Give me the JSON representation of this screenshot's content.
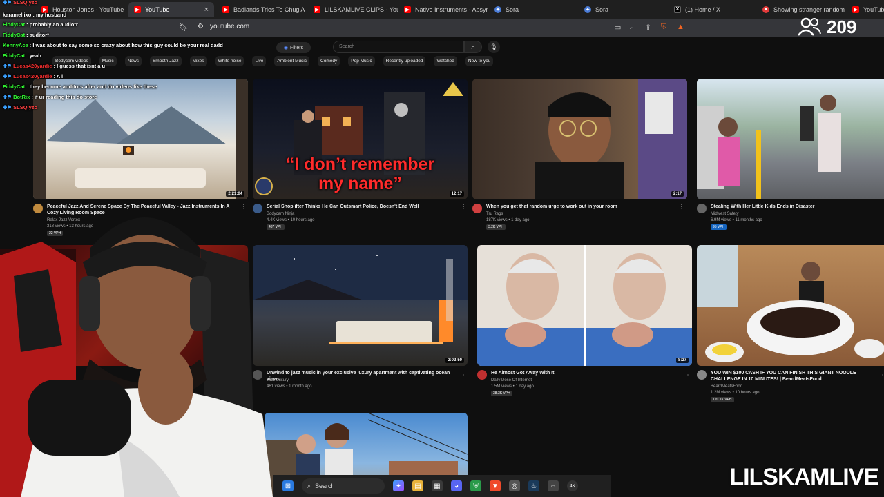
{
  "browser": {
    "tabs": [
      {
        "label": "Houston Jones - YouTube",
        "color": "#ff0000"
      },
      {
        "label": "YouTube",
        "color": "#ff0000",
        "active": true
      },
      {
        "label": "Badlands Tries To Chug A P",
        "color": "#ff0000"
      },
      {
        "label": "LILSKAMLIVE CLIPS - YouTu",
        "color": "#ff0000"
      },
      {
        "label": "Native Instruments - Absym",
        "color": "#ff0000"
      },
      {
        "label": "Sora",
        "color": "#4a7bd6"
      },
      {
        "label": "Sora",
        "color": "#4a7bd6"
      },
      {
        "label": "(1) Home / X",
        "color": "#000000"
      },
      {
        "label": "Showing stranger random",
        "color": "#e23b3b"
      },
      {
        "label": "YouTube",
        "color": "#ff0000"
      }
    ],
    "url": "youtube.com"
  },
  "youtube": {
    "filters_label": "Filters",
    "search_placeholder": "Search",
    "chips": [
      "Bodycam videos",
      "Music",
      "News",
      "Smooth Jazz",
      "Mixes",
      "White noise",
      "Live",
      "Ambient Music",
      "Comedy",
      "Pop Music",
      "Recently uploaded",
      "Watched",
      "New to you"
    ],
    "videos": [
      {
        "title": "Peaceful Jazz And Serene Space By The Peaceful Valley - Jazz Instruments In A Cozy Living Room Space",
        "channel": "Relax Jazz Vortex",
        "stats": "318 views • 13 hours ago",
        "vph": "22 VPH",
        "duration": "2:21:04",
        "avatar": "#c08a3e"
      },
      {
        "title": "Serial Shoplifter Thinks He Can Outsmart Police, Doesn't End Well",
        "channel": "Bodycam Ninja",
        "stats": "4.4K views • 10 hours ago",
        "vph": "437 VPH",
        "duration": "12:17",
        "avatar": "#3a5b8a"
      },
      {
        "title": "When you get that random urge to work out in your room",
        "channel": "Tru Rags",
        "stats": "187K views • 1 day ago",
        "vph": "3.2K VPH",
        "duration": "2:17",
        "avatar": "#d04040"
      },
      {
        "title": "Stealing With Her Little Kids Ends in Disaster",
        "channel": "Midwest Safety",
        "stats": "6.9M views • 11 months ago",
        "vph": "95 VPH",
        "duration": "",
        "avatar": "#666666"
      },
      {
        "title": "",
        "channel": "",
        "stats": "",
        "vph": "",
        "duration": "",
        "avatar": "#444444"
      },
      {
        "title": "Unwind to jazz music in your exclusive luxury apartment with captivating ocean views",
        "channel": "Jazz Luxury",
        "stats": "461 views • 1 month ago",
        "vph": "",
        "duration": "2:02:50",
        "avatar": "#555555"
      },
      {
        "title": "He Almost Got Away With It",
        "channel": "Daily Dose Of Internet",
        "stats": "1.5M views • 1 day ago",
        "vph": "38.3K VPH",
        "duration": "8:27",
        "avatar": "#c03030"
      },
      {
        "title": "YOU WIN $100 CASH IF YOU CAN FINISH THIS GIANT NOODLE CHALLENGE IN 10 MINUTES! | BeardMeatsFood",
        "channel": "BeardMeatsFood",
        "stats": "1.2M views • 10 hours ago",
        "vph": "120.1K VPH",
        "duration": "",
        "avatar": "#888888"
      },
      {
        "title": "",
        "channel": "",
        "stats": "",
        "vph": "",
        "duration": "",
        "avatar": "#444444"
      }
    ],
    "thumb_text": "“I don’t remember my name”"
  },
  "chat": [
    {
      "user": "",
      "msg": "SLSQlyzo",
      "color": "#ff4040"
    },
    {
      "user": "karamellixo",
      "msg": "my husband",
      "color": "#ffffff"
    },
    {
      "user": "FiddyCat",
      "msg": "probably an audiotr",
      "color": "#33ff33"
    },
    {
      "user": "FiddyCat",
      "msg": "auditor*",
      "color": "#33ff33"
    },
    {
      "user": "KennyAce",
      "msg": "I was about to say some so crazy about how this guy could be your real dadd",
      "color": "#33ff33"
    },
    {
      "user": "FiddyCat",
      "msg": "yeah",
      "color": "#33ff33"
    },
    {
      "user": "Lucas420yardie",
      "msg": "I guess that isnt a u",
      "color": "#ff3030"
    },
    {
      "user": "Lucas420yardie",
      "msg": "A i",
      "color": "#ff3030"
    },
    {
      "user": "FiddyCat",
      "msg": "they become auditors after and do videos like these",
      "color": "#33ff33"
    },
    {
      "user": "BotRix",
      "msg": "if ur reading this do store",
      "color": "#33ff33"
    },
    {
      "user": "SLSQlyzo",
      "msg": "",
      "color": "#ff4040"
    }
  ],
  "stream": {
    "viewer_count": "209",
    "brand": "LILSKAMLIVE"
  },
  "taskbar": {
    "search_label": "Search",
    "items": [
      "windows-start",
      "search",
      "copilot",
      "file-explorer",
      "store",
      "discord",
      "shield",
      "brave",
      "chrome",
      "steam",
      "app",
      "4k"
    ]
  }
}
